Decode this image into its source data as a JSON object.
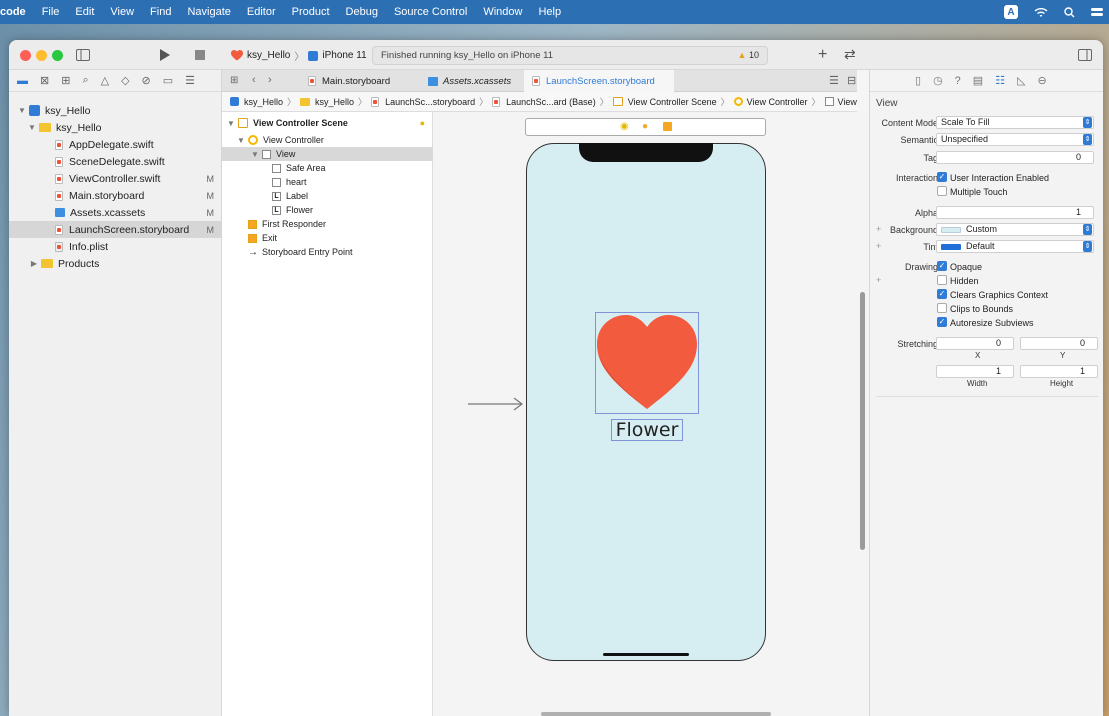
{
  "menubar": {
    "app_name": "code",
    "items": [
      "File",
      "Edit",
      "View",
      "Find",
      "Navigate",
      "Editor",
      "Product",
      "Debug",
      "Source Control",
      "Window",
      "Help"
    ],
    "input_badge": "A"
  },
  "toolbar": {
    "scheme_project": "ksy_Hello",
    "scheme_device": "iPhone 11",
    "status_text": "Finished running ksy_Hello on iPhone 11",
    "warning_count": "10",
    "add_label": "+",
    "swap_label": "⇄"
  },
  "navigator": {
    "items": [
      {
        "label": "ksy_Hello",
        "icon": "project-icon",
        "badge": ""
      },
      {
        "label": "ksy_Hello",
        "icon": "folder-icon",
        "badge": ""
      },
      {
        "label": "AppDelegate.swift",
        "icon": "swift-file-icon",
        "badge": ""
      },
      {
        "label": "SceneDelegate.swift",
        "icon": "swift-file-icon",
        "badge": ""
      },
      {
        "label": "ViewController.swift",
        "icon": "swift-file-icon",
        "badge": "M"
      },
      {
        "label": "Main.storyboard",
        "icon": "storyboard-icon",
        "badge": "M"
      },
      {
        "label": "Assets.xcassets",
        "icon": "assets-icon",
        "badge": "M"
      },
      {
        "label": "LaunchScreen.storyboard",
        "icon": "storyboard-icon",
        "badge": "M"
      },
      {
        "label": "Info.plist",
        "icon": "plist-icon",
        "badge": ""
      },
      {
        "label": "Products",
        "icon": "folder-icon",
        "badge": ""
      }
    ]
  },
  "tabs": [
    {
      "label": "Main.storyboard"
    },
    {
      "label": "Assets.xcassets"
    },
    {
      "label": "LaunchScreen.storyboard"
    }
  ],
  "jumpbar": [
    "ksy_Hello",
    "ksy_Hello",
    "LaunchSc...storyboard",
    "LaunchSc...ard (Base)",
    "View Controller Scene",
    "View Controller",
    "View"
  ],
  "outline": {
    "items": [
      {
        "label": "View Controller Scene"
      },
      {
        "label": "View Controller"
      },
      {
        "label": "View"
      },
      {
        "label": "Safe Area"
      },
      {
        "label": "heart"
      },
      {
        "label": "Label"
      },
      {
        "label": "Flower"
      },
      {
        "label": "First Responder"
      },
      {
        "label": "Exit"
      },
      {
        "label": "Storyboard Entry Point"
      }
    ]
  },
  "canvas": {
    "label_text": "Flower",
    "heart_color": "#f35b3f",
    "background_color": "#d6eef2"
  },
  "inspector": {
    "section_title": "View",
    "content_mode_label": "Content Mode",
    "content_mode_value": "Scale To Fill",
    "semantic_label": "Semantic",
    "semantic_value": "Unspecified",
    "tag_label": "Tag",
    "tag_value": "0",
    "interaction_label": "Interaction",
    "user_interaction": "User Interaction Enabled",
    "multiple_touch": "Multiple Touch",
    "alpha_label": "Alpha",
    "alpha_value": "1",
    "background_label": "Background",
    "background_value": "Custom",
    "tint_label": "Tint",
    "tint_value": "Default",
    "drawing_label": "Drawing",
    "opaque": "Opaque",
    "hidden": "Hidden",
    "clears_graphics": "Clears Graphics Context",
    "clips_to_bounds": "Clips to Bounds",
    "autoresize": "Autoresize Subviews",
    "stretching_label": "Stretching",
    "stretch_x_value": "0",
    "stretch_y_value": "0",
    "stretch_x_label": "X",
    "stretch_y_label": "Y",
    "width_value": "1",
    "height_value": "1",
    "width_label": "Width",
    "height_label": "Height",
    "tint_color": "#1f6fd6",
    "background_swatch": "#d6eef2"
  }
}
